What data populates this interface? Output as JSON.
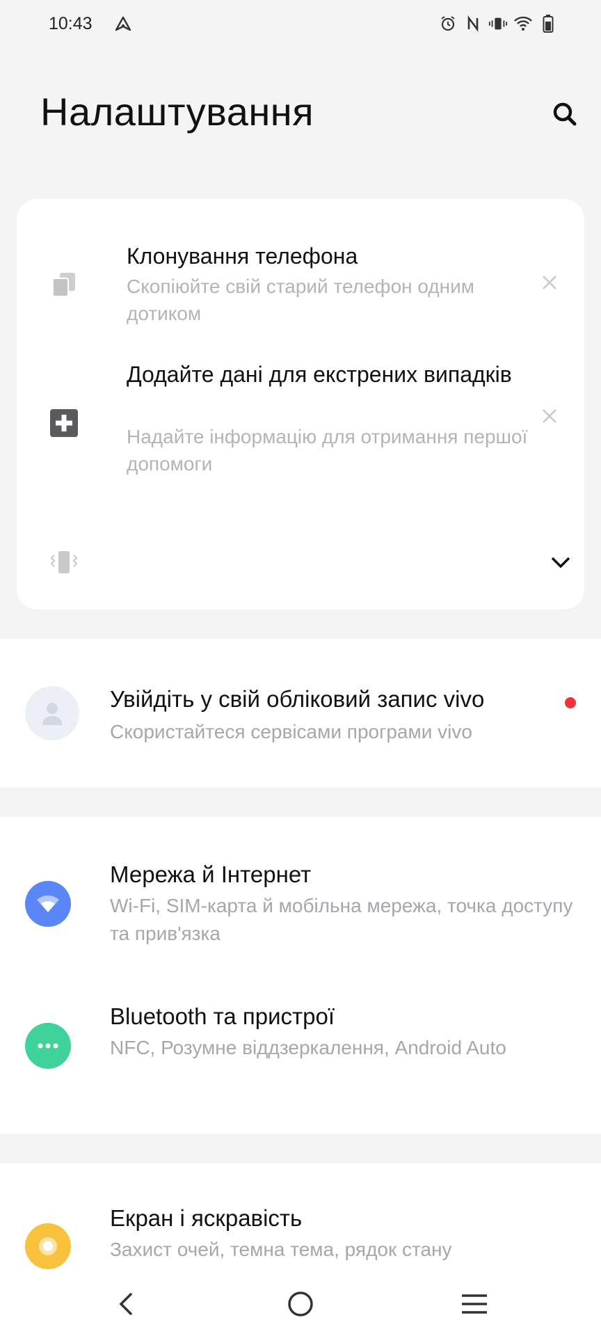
{
  "status_bar": {
    "time": "10:43",
    "left_icon": "navigation-icon",
    "right_icons": [
      "alarm-icon",
      "nfc-icon",
      "vibrate-icon",
      "wifi-icon",
      "battery-icon"
    ]
  },
  "header": {
    "title": "Налаштування",
    "search_icon": "search-icon"
  },
  "suggestions": {
    "items": [
      {
        "icon": "clone-phone-icon",
        "title": "Клонування телефона",
        "subtitle": "Скопіюйте свій старий телефон одним дотиком"
      },
      {
        "icon": "medical-plus-icon",
        "title": "Додайте дані для екстрених випадків",
        "subtitle": "Надайте інформацію для отримання першої допомоги"
      }
    ],
    "collapsed_icon": "vibrate-phone-icon",
    "expand_icon": "chevron-down-icon"
  },
  "account": {
    "title": "Увійдіть у свій обліковий запис vivo",
    "subtitle": "Скористайтеся сервісами програми vivo",
    "dot_color": "#f0323f"
  },
  "settings": [
    {
      "title": "Мережа й Інтернет",
      "subtitle": "Wi-Fi, SIM-карта й мобільна мережа, точка доступу та прив'язка",
      "icon": "wifi-icon",
      "color": "#5b86f5"
    },
    {
      "title": "Bluetooth та пристрої",
      "subtitle": "NFC, Розумне віддзеркалення, Android Auto",
      "icon": "devices-dots-icon",
      "color": "#3fd39b"
    },
    {
      "title": "Екран і яскравість",
      "subtitle": "Захист очей, темна тема, рядок стану",
      "icon": "brightness-icon",
      "color": "#f8c23c"
    }
  ],
  "nav_bar": {
    "back_icon": "back-icon",
    "home_icon": "home-icon",
    "menu_icon": "menu-icon"
  }
}
